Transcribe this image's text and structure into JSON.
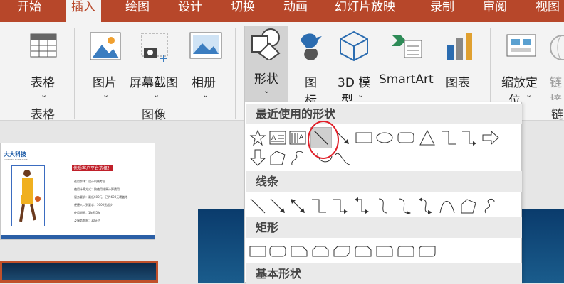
{
  "tabs": [
    "开始",
    "插入",
    "绘图",
    "设计",
    "切换",
    "动画",
    "幻灯片放映",
    "录制",
    "审阅",
    "视图"
  ],
  "ribbon": {
    "table": "表格",
    "picture": "图片",
    "screenshot": "屏幕截图",
    "album": "相册",
    "shapes": "形状",
    "icon1": "图",
    "icon2": "标",
    "model1": "3D 模",
    "model2": "型",
    "smartart": "SmartArt",
    "chart": "图表",
    "zoom1": "缩放定",
    "zoom2": "位",
    "link1": "链",
    "link2": "接",
    "groups": {
      "table": "表格",
      "images": "图像",
      "links": "链"
    }
  },
  "menu": {
    "recent": "最近使用的形状",
    "lines": "线条",
    "rect": "矩形",
    "basic": "基本形状"
  },
  "slide": {
    "company": "大大科技",
    "subtitle": "COMPANY NAME TITLE",
    "heading": "优质客户平台选择！",
    "bullets": [
      "适用群体：设计机械专业",
      "使用计算方式：按使用结果计算费用",
      "服务要求：最低600元，已为600元覆盖地",
      "便捷入口到要求：5000元起步",
      "使用期限：1年到5年",
      "及服务期限：30天内"
    ]
  },
  "colors": {
    "accent": "#b7472a",
    "highlight_circle": "#e0202a"
  }
}
